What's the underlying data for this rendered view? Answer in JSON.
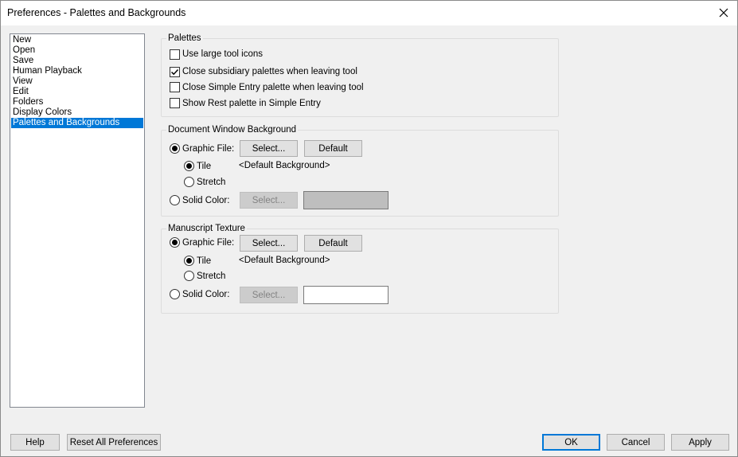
{
  "window": {
    "title": "Preferences - Palettes and Backgrounds"
  },
  "categories": [
    "New",
    "Open",
    "Save",
    "Human Playback",
    "View",
    "Edit",
    "Folders",
    "Display Colors",
    "Palettes and Backgrounds"
  ],
  "selected_category": "Palettes and Backgrounds",
  "palettes": {
    "label": "Palettes",
    "options": [
      {
        "label": "Use large tool icons",
        "checked": false
      },
      {
        "label": "Close subsidiary palettes when leaving tool",
        "checked": true
      },
      {
        "label": "Close Simple Entry palette when leaving tool",
        "checked": false
      },
      {
        "label": "Show Rest palette in Simple Entry",
        "checked": false
      }
    ]
  },
  "document_background": {
    "label": "Document Window Background",
    "graphic_file_label": "Graphic File:",
    "select_label": "Select...",
    "default_label": "Default",
    "tile_label": "Tile",
    "stretch_label": "Stretch",
    "file_value": "<Default Background>",
    "solid_color_label": "Solid Color:",
    "solid_select_label": "Select...",
    "mode": "graphic",
    "fit": "tile",
    "solid_color": "#bebebe"
  },
  "manuscript_texture": {
    "label": "Manuscript Texture",
    "graphic_file_label": "Graphic File:",
    "select_label": "Select...",
    "default_label": "Default",
    "tile_label": "Tile",
    "stretch_label": "Stretch",
    "file_value": "<Default Background>",
    "solid_color_label": "Solid Color:",
    "solid_select_label": "Select...",
    "mode": "graphic",
    "fit": "tile",
    "solid_color": "#ffffff"
  },
  "footer": {
    "help_label": "Help",
    "reset_label": "Reset All Preferences",
    "ok_label": "OK",
    "cancel_label": "Cancel",
    "apply_label": "Apply"
  },
  "colors": {
    "selection": "#0078d7",
    "dialog_bg": "#f0f0f0"
  },
  "icons": {
    "close": "close-icon",
    "check": "checkmark-icon"
  }
}
